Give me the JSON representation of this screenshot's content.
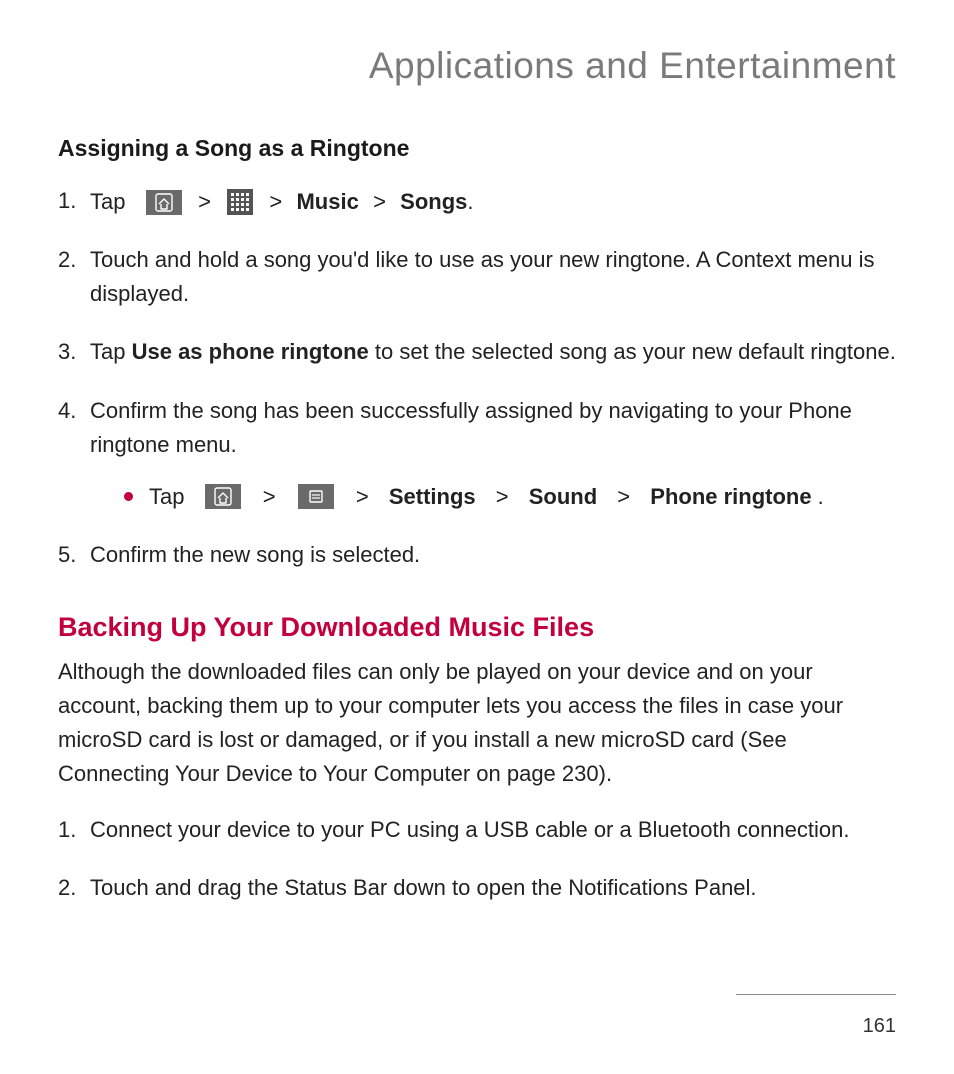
{
  "chapter_title": "Applications and Entertainment",
  "section_a": {
    "heading": "Assigning a Song as a Ringtone",
    "step1_tap": "Tap",
    "step1_music": "Music",
    "step1_songs": "Songs",
    "step2": "Touch and hold a song you'd like to use as your new ringtone. A Context menu is displayed.",
    "step3_pre": "Tap ",
    "step3_bold": "Use as phone ringtone",
    "step3_post": " to set the selected song as your new default ringtone.",
    "step4": "Confirm the song has been successfully assigned by navigating to your Phone ringtone menu.",
    "step4_bullet_tap": "Tap",
    "step4_b_settings": "Settings",
    "step4_b_sound": "Sound",
    "step4_b_phone": "Phone ringtone",
    "step5": "Confirm the new song is selected."
  },
  "section_b": {
    "heading": "Backing Up Your Downloaded Music Files",
    "intro": "Although the downloaded  files can only be played on your device and on your account, backing them up to your computer lets you access the files in case your microSD card is lost or damaged, or if you install a new microSD card (See Connecting Your Device to Your Computer on page 230).",
    "step1": "Connect your device to your PC using a USB cable or a Bluetooth connection.",
    "step2": "Touch and drag the Status Bar down to open the Notifications Panel."
  },
  "glyphs": {
    "chevron": ">",
    "period": "."
  },
  "page_number": "161"
}
